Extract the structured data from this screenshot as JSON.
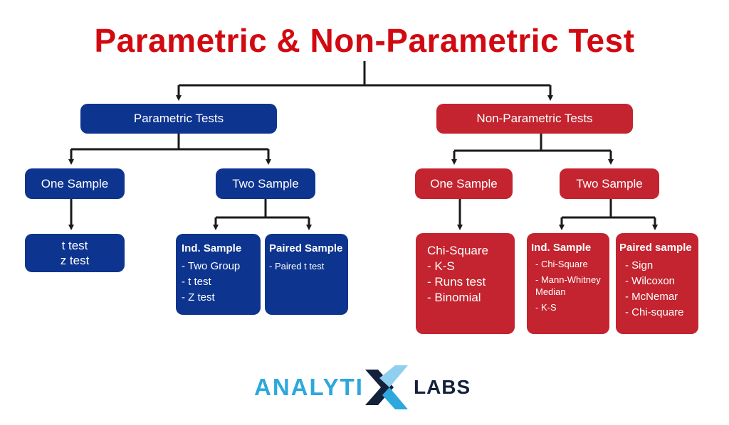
{
  "title": "Parametric & Non-Parametric Test",
  "colors": {
    "title": "#d10a11",
    "parametric": "#0d348f",
    "nonparametric": "#c3242f",
    "lines": "#1a1a1a"
  },
  "parametric": {
    "label": "Parametric Tests",
    "one_sample": {
      "label": "One Sample",
      "tests": [
        "t test",
        "z test"
      ]
    },
    "two_sample": {
      "label": "Two Sample",
      "independent": {
        "title": "Ind. Sample",
        "items": [
          "- Two Group",
          "- t test",
          "- Z test"
        ]
      },
      "paired": {
        "title": "Paired Sample",
        "items": [
          "- Paired t test"
        ]
      }
    }
  },
  "nonparametric": {
    "label": "Non-Parametric Tests",
    "one_sample": {
      "label": "One Sample",
      "tests": [
        "Chi-Square",
        "- K-S",
        "- Runs test",
        "- Binomial"
      ]
    },
    "two_sample": {
      "label": "Two Sample",
      "independent": {
        "title": "Ind. Sample",
        "items": [
          "- Chi-Square",
          "- Mann-Whitney Median",
          "- K-S"
        ]
      },
      "paired": {
        "title": "Paired sample",
        "items": [
          "- Sign",
          "- Wilcoxon",
          "- McNemar",
          "- Chi-square"
        ]
      }
    }
  },
  "logo": {
    "part1": "ANALYTI",
    "mark": "X",
    "part2": "LABS"
  }
}
